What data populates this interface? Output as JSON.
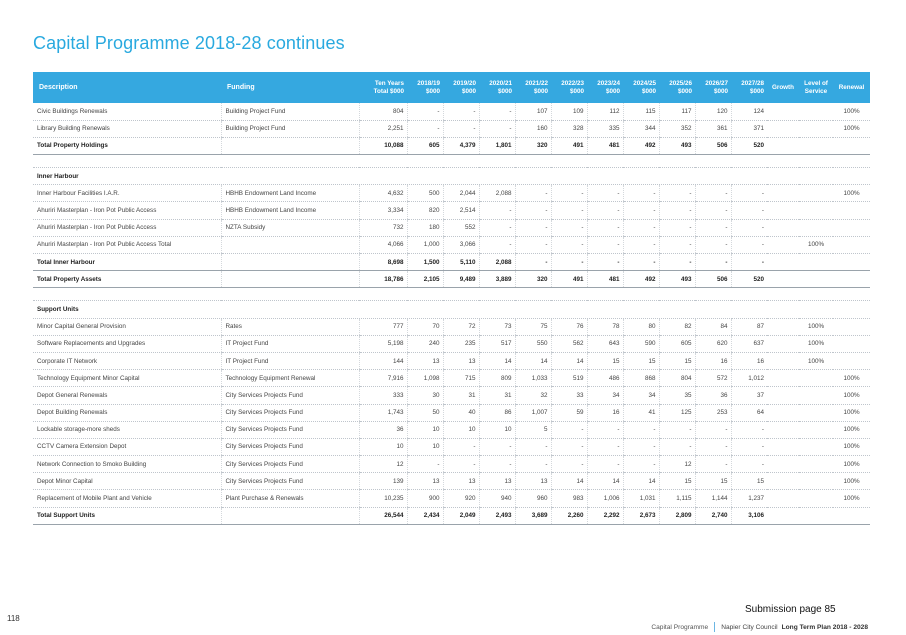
{
  "page": {
    "title": "Capital Programme 2018-28 continues",
    "page_number": "118",
    "submission": "Submission page 85",
    "footer_section": "Capital Programme",
    "footer_org": "Napier City Council",
    "footer_plan": "Long Term Plan 2018 - 2028"
  },
  "colors": {
    "title": "#29a9df",
    "header_bg": "#35a8e0",
    "footer_separator": "#6bb6e3"
  },
  "table": {
    "headers": [
      "Description",
      "Funding",
      "Ten Years Total $000",
      "2018/19 $000",
      "2019/20 $000",
      "2020/21 $000",
      "2021/22 $000",
      "2022/23 $000",
      "2023/24 $000",
      "2024/25 $000",
      "2025/26 $000",
      "2026/27 $000",
      "2027/28 $000",
      "Growth",
      "Level of Service",
      "Renewal"
    ],
    "rows": [
      {
        "type": "item",
        "cells": [
          "Civic Buildings Renewals",
          "Building Project Fund",
          "804",
          "-",
          "-",
          "-",
          "107",
          "109",
          "112",
          "115",
          "117",
          "120",
          "124",
          "",
          "",
          "100%"
        ]
      },
      {
        "type": "item",
        "cells": [
          "Library Building Renewals",
          "Building Project Fund",
          "2,251",
          "-",
          "-",
          "-",
          "160",
          "328",
          "335",
          "344",
          "352",
          "361",
          "371",
          "",
          "",
          "100%"
        ]
      },
      {
        "type": "total",
        "cells": [
          "Total Property Holdings",
          "",
          "10,088",
          "605",
          "4,379",
          "1,801",
          "320",
          "491",
          "481",
          "492",
          "493",
          "506",
          "520",
          "",
          "",
          ""
        ]
      },
      {
        "type": "spacer",
        "cells": []
      },
      {
        "type": "section",
        "cells": [
          "Inner Harbour"
        ]
      },
      {
        "type": "item",
        "cells": [
          "Inner Harbour Facilities I.A.R.",
          "HBHB Endowment Land Income",
          "4,632",
          "500",
          "2,044",
          "2,088",
          "-",
          "-",
          "-",
          "-",
          "-",
          "-",
          "-",
          "",
          "",
          "100%"
        ]
      },
      {
        "type": "item",
        "cells": [
          "Ahuriri Masterplan - Iron Pot Public Access",
          "HBHB Endowment Land Income",
          "3,334",
          "820",
          "2,514",
          "-",
          "-",
          "-",
          "-",
          "-",
          "-",
          "-",
          "-",
          "",
          "",
          ""
        ]
      },
      {
        "type": "item",
        "cells": [
          "Ahuriri Masterplan - Iron Pot Public Access",
          "NZTA Subsidy",
          "732",
          "180",
          "552",
          "-",
          "-",
          "-",
          "-",
          "-",
          "-",
          "-",
          "-",
          "",
          "",
          ""
        ]
      },
      {
        "type": "item",
        "cells": [
          "Ahuriri Masterplan - Iron Pot Public Access Total",
          "",
          "4,066",
          "1,000",
          "3,066",
          "-",
          "-",
          "-",
          "-",
          "-",
          "-",
          "-",
          "-",
          "",
          "100%",
          ""
        ]
      },
      {
        "type": "total",
        "cells": [
          "Total Inner Harbour",
          "",
          "8,698",
          "1,500",
          "5,110",
          "2,088",
          "-",
          "-",
          "-",
          "-",
          "-",
          "-",
          "-",
          "",
          "",
          ""
        ]
      },
      {
        "type": "total",
        "cells": [
          "Total Property Assets",
          "",
          "18,786",
          "2,105",
          "9,489",
          "3,889",
          "320",
          "491",
          "481",
          "492",
          "493",
          "506",
          "520",
          "",
          "",
          ""
        ]
      },
      {
        "type": "spacer",
        "cells": []
      },
      {
        "type": "section",
        "cells": [
          "Support Units"
        ]
      },
      {
        "type": "item",
        "cells": [
          "Minor Capital General Provision",
          "Rates",
          "777",
          "70",
          "72",
          "73",
          "75",
          "76",
          "78",
          "80",
          "82",
          "84",
          "87",
          "",
          "100%",
          ""
        ]
      },
      {
        "type": "item",
        "cells": [
          "Software Replacements and Upgrades",
          "IT Project Fund",
          "5,198",
          "240",
          "235",
          "517",
          "550",
          "562",
          "643",
          "590",
          "605",
          "620",
          "637",
          "",
          "100%",
          ""
        ]
      },
      {
        "type": "item",
        "cells": [
          "Corporate IT Network",
          "IT Project Fund",
          "144",
          "13",
          "13",
          "14",
          "14",
          "14",
          "15",
          "15",
          "15",
          "16",
          "16",
          "",
          "100%",
          ""
        ]
      },
      {
        "type": "item",
        "cells": [
          "Technology Equipment Minor Capital",
          "Technology Equipment Renewal",
          "7,916",
          "1,098",
          "715",
          "809",
          "1,033",
          "519",
          "486",
          "868",
          "804",
          "572",
          "1,012",
          "",
          "",
          "100%"
        ]
      },
      {
        "type": "item",
        "cells": [
          "Depot General Renewals",
          "City Services Projects Fund",
          "333",
          "30",
          "31",
          "31",
          "32",
          "33",
          "34",
          "34",
          "35",
          "36",
          "37",
          "",
          "",
          "100%"
        ]
      },
      {
        "type": "item",
        "cells": [
          "Depot Building Renewals",
          "City Services Projects Fund",
          "1,743",
          "50",
          "40",
          "86",
          "1,007",
          "59",
          "16",
          "41",
          "125",
          "253",
          "64",
          "",
          "",
          "100%"
        ]
      },
      {
        "type": "item",
        "cells": [
          "Lockable storage-more sheds",
          "City Services Projects Fund",
          "36",
          "10",
          "10",
          "10",
          "5",
          "-",
          "-",
          "-",
          "-",
          "-",
          "-",
          "",
          "",
          "100%"
        ]
      },
      {
        "type": "item",
        "cells": [
          "CCTV Camera Extension Depot",
          "City Services Projects Fund",
          "10",
          "10",
          "-",
          "-",
          "-",
          "-",
          "-",
          "-",
          "-",
          "-",
          "-",
          "",
          "",
          "100%"
        ]
      },
      {
        "type": "item",
        "cells": [
          "Network Connection to Smoko Building",
          "City Services Projects Fund",
          "12",
          "-",
          "-",
          "-",
          "-",
          "-",
          "-",
          "-",
          "12",
          "-",
          "-",
          "",
          "",
          "100%"
        ]
      },
      {
        "type": "item",
        "cells": [
          "Depot Minor Capital",
          "City Services Projects Fund",
          "139",
          "13",
          "13",
          "13",
          "13",
          "14",
          "14",
          "14",
          "15",
          "15",
          "15",
          "",
          "",
          "100%"
        ]
      },
      {
        "type": "item",
        "cells": [
          "Replacement of Mobile Plant and Vehicle",
          "Plant Purchase & Renewals",
          "10,235",
          "900",
          "920",
          "940",
          "960",
          "983",
          "1,006",
          "1,031",
          "1,115",
          "1,144",
          "1,237",
          "",
          "",
          "100%"
        ]
      },
      {
        "type": "total",
        "cells": [
          "Total Support Units",
          "",
          "26,544",
          "2,434",
          "2,049",
          "2,493",
          "3,689",
          "2,260",
          "2,292",
          "2,673",
          "2,809",
          "2,740",
          "3,106",
          "",
          "",
          ""
        ]
      }
    ]
  }
}
